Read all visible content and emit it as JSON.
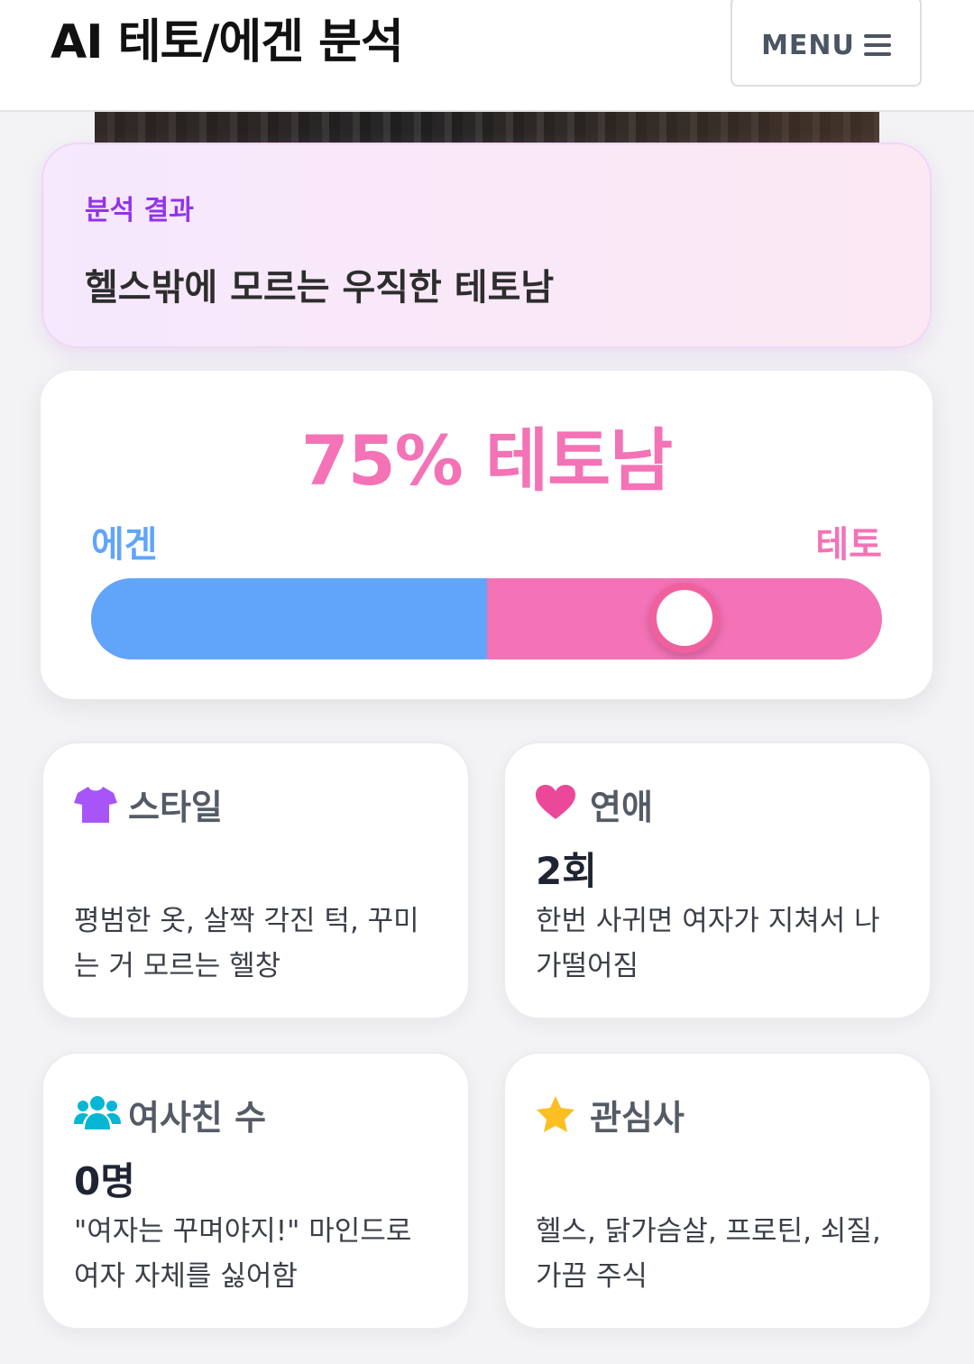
{
  "header": {
    "title": "AI 테토/에겐 분석",
    "menu_label": "MENU"
  },
  "result": {
    "label": "분석 결과",
    "title": "헬스밖에 모르는 우직한 테토남"
  },
  "score": {
    "headline": "75% 테토남",
    "left_label": "에겐",
    "right_label": "테토",
    "teto_percent": 75,
    "bar_split_fraction": 0.5,
    "colors": {
      "egen": "#60a5fa",
      "teto": "#f472b6"
    }
  },
  "cards": [
    {
      "icon": "shirt-icon",
      "title": "스타일",
      "value": "",
      "desc": "평범한 옷, 살짝 각진 턱, 꾸미는 거 모르는 헬창",
      "icon_color": "#a855f7"
    },
    {
      "icon": "heart-icon",
      "title": "연애",
      "value": "2회",
      "desc": "한번 사귀면 여자가 지쳐서 나가떨어짐",
      "icon_color": "#ec4899"
    },
    {
      "icon": "users-icon",
      "title": "여사친 수",
      "value": "0명",
      "desc": "\"여자는 꾸며야지!\" 마인드로 여자 자체를 싫어함",
      "icon_color": "#06b6d4"
    },
    {
      "icon": "star-icon",
      "title": "관심사",
      "value": "",
      "desc": "헬스, 닭가슴살, 프로틴, 쇠질, 가끔 주식",
      "icon_color": "#fbbf24"
    }
  ]
}
